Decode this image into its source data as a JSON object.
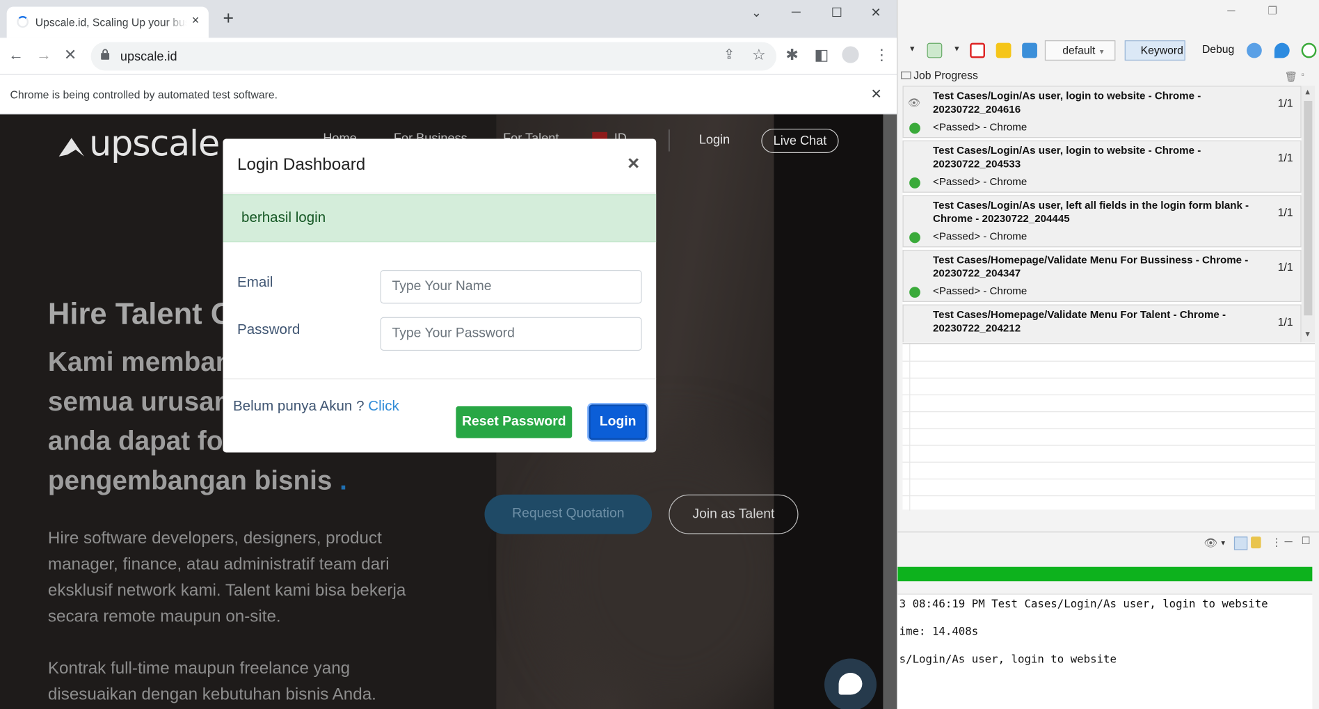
{
  "browser": {
    "tab_title": "Upscale.id, Scaling Up your business",
    "tab_close": "×",
    "new_tab": "+",
    "url": "upscale.id",
    "infobar_text": "Chrome is being controlled by automated test software.",
    "infobar_close": "✕"
  },
  "site": {
    "logo_text": "upscale",
    "nav": [
      "Home",
      "For Business",
      "For Talent",
      "ID"
    ],
    "login": "Login",
    "live_chat": "Live Chat",
    "hero_title": "Hire Talent O",
    "hero_lines": [
      "Kami membantu",
      "semua urusan \"",
      "anda dapat fok",
      "pengembangan bisnis"
    ],
    "hero_dot": ".",
    "hero_para": [
      "Hire software developers, designers, product",
      "manager, finance, atau administratif team dari",
      "eksklusif network kami. Talent kami bisa bekerja",
      "secara remote maupun on-site."
    ],
    "hero_para2": [
      "Kontrak full-time maupun freelance yang",
      "disesuaikan dengan kebutuhan bisnis Anda."
    ],
    "btn_quotation": "Request Quotation",
    "btn_join": "Join as Talent"
  },
  "modal": {
    "title": "Login Dashboard",
    "close": "×",
    "alert": "berhasil login",
    "email_label": "Email",
    "email_placeholder": "Type Your Name",
    "password_label": "Password",
    "password_placeholder": "Type Your Password",
    "signup_text": "Belum punya Akun ?",
    "signup_link": "Click",
    "reset_button": "Reset Password",
    "login_button": "Login"
  },
  "katalon": {
    "profile": "default",
    "keyword_button": "Keyword",
    "debug_button": "Debug",
    "job_progress_title": "Job Progress",
    "jobs": [
      {
        "name": "Test Cases/Login/As user, login to website - Chrome - 20230722_204616",
        "count": "1/1",
        "status": "<Passed> - Chrome"
      },
      {
        "name": "Test Cases/Login/As user, login to website - Chrome - 20230722_204533",
        "count": "1/1",
        "status": "<Passed> - Chrome"
      },
      {
        "name": "Test Cases/Login/As user, left all fields in the login form blank - Chrome - 20230722_204445",
        "count": "1/1",
        "status": "<Passed> - Chrome"
      },
      {
        "name": "Test Cases/Homepage/Validate Menu For Bussiness - Chrome - 20230722_204347",
        "count": "1/1",
        "status": "<Passed> - Chrome"
      },
      {
        "name": "Test Cases/Homepage/Validate Menu For Talent - Chrome - 20230722_204212",
        "count": "1/1",
        "status": ""
      }
    ],
    "console_lines": [
      "3 08:46:19 PM Test Cases/Login/As user, login to website",
      "ime: 14.408s",
      "s/Login/As user, login to website"
    ],
    "colors": {
      "progress": "#0db21d",
      "passed": "#3aaa3a"
    }
  }
}
